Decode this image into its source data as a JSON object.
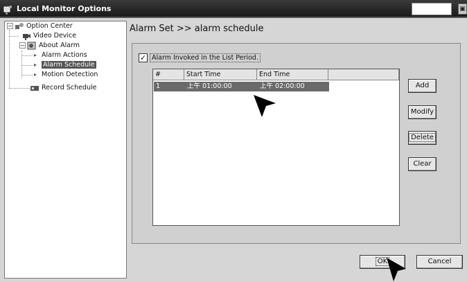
{
  "window": {
    "title": "Local Monitor Options"
  },
  "tree": {
    "items": [
      {
        "label": "Option Center",
        "icon": "option-center-icon"
      },
      {
        "label": "Video Device",
        "icon": "camera-icon"
      },
      {
        "label": "About Alarm",
        "icon": "alarm-icon"
      },
      {
        "label": "Alarm Actions"
      },
      {
        "label": "Alarm Schedule",
        "selected": true
      },
      {
        "label": "Motion Detection"
      },
      {
        "label": "Record Schedule",
        "icon": "record-icon"
      }
    ]
  },
  "breadcrumb": "Alarm Set >> alarm schedule",
  "checkbox": {
    "label": "Alarm Invoked in the List Period.",
    "checked": true,
    "mark": "✓"
  },
  "list": {
    "columns": [
      "#",
      "Start Time",
      "End Time",
      ""
    ],
    "rows": [
      {
        "index": "1",
        "start": "上午 01:00:00",
        "end": "上午 02:00:00"
      }
    ]
  },
  "buttons": {
    "add": "Add",
    "modify": "Modify",
    "delete": "Delete",
    "clear": "Clear",
    "ok": "OK",
    "cancel": "Cancel"
  }
}
